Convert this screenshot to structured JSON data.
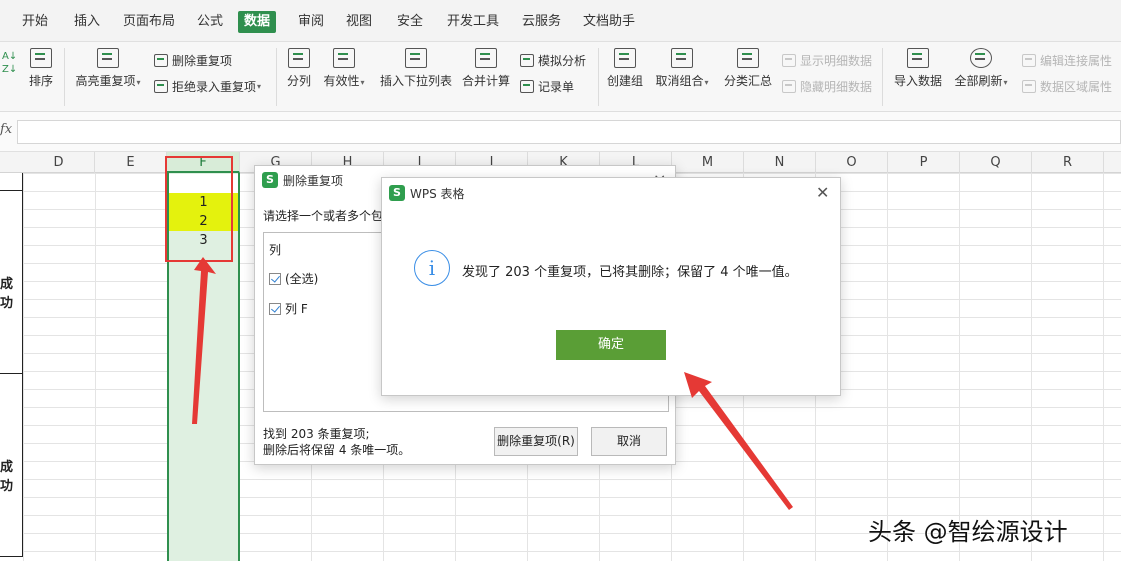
{
  "menu": {
    "tabs": [
      "开始",
      "插入",
      "页面布局",
      "公式",
      "数据",
      "审阅",
      "视图",
      "安全",
      "开发工具",
      "云服务",
      "文档助手"
    ],
    "active": "数据"
  },
  "ribbon": {
    "sort_top": "AZ↓",
    "sort_label": "排序",
    "highlight_dup": "高亮重复项",
    "remove_dup": "删除重复项",
    "reject_dup": "拒绝录入重复项",
    "split": "分列",
    "validity": "有效性",
    "insert_dropdown": "插入下拉列表",
    "consolidate": "合并计算",
    "what_if": "模拟分析",
    "record_sheet": "记录单",
    "create_group": "创建组",
    "ungroup": "取消组合",
    "subtotal": "分类汇总",
    "show_detail": "显示明细数据",
    "hide_detail": "隐藏明细数据",
    "import_data": "导入数据",
    "refresh_all": "全部刷新",
    "edit_links": "编辑连接属性",
    "data_range": "数据区域属性"
  },
  "formula_bar": {
    "fx": "fx",
    "value": ""
  },
  "columns": [
    "D",
    "E",
    "F",
    "G",
    "H",
    "I",
    "J",
    "K",
    "L",
    "M",
    "N",
    "O",
    "P",
    "Q",
    "R"
  ],
  "left_cells": [
    "成功",
    "成功"
  ],
  "column_f_cells": [
    "1",
    "2",
    "3"
  ],
  "remove_dialog": {
    "title": "删除重复项",
    "prompt": "请选择一个或者多个包",
    "list_header": "列",
    "options": [
      "(全选)",
      "列 F"
    ],
    "footer_line1": "找到 203 条重复项;",
    "footer_line2": "删除后将保留 4 条唯一项。",
    "remove_button": "删除重复项(R)",
    "cancel_button": "取消"
  },
  "wps_dialog": {
    "logo": "S",
    "title": "WPS 表格",
    "message": "发现了 203 个重复项，已将其删除；保留了 4 个唯一值。",
    "ok_button": "确定"
  },
  "watermark": "头条 @智绘源设计",
  "colors": {
    "accent_green": "#2f8f4e",
    "highlight_yellow": "#e4f20d",
    "annotation_red": "#e53935",
    "ok_green": "#5a9e36",
    "info_blue": "#3a8ee6"
  }
}
